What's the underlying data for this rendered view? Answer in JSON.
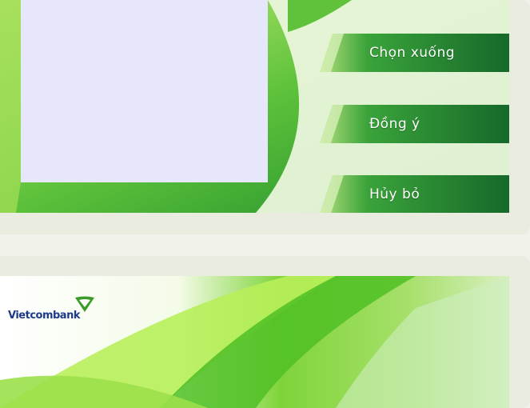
{
  "top_screen": {
    "buttons": [
      {
        "label": "Chọn xuống"
      },
      {
        "label": "Đồng ý"
      },
      {
        "label": "Hủy bỏ"
      }
    ]
  },
  "bottom_screen": {
    "brand": "Vietcombank",
    "brand_tagline": "",
    "logo_icon": "vietcombank-shield-icon"
  },
  "colors": {
    "button_green": "#1f7a2e",
    "button_light": "#9ad26a",
    "brand_blue": "#1d3a8a",
    "panel_lavender": "#e6e7fb"
  }
}
